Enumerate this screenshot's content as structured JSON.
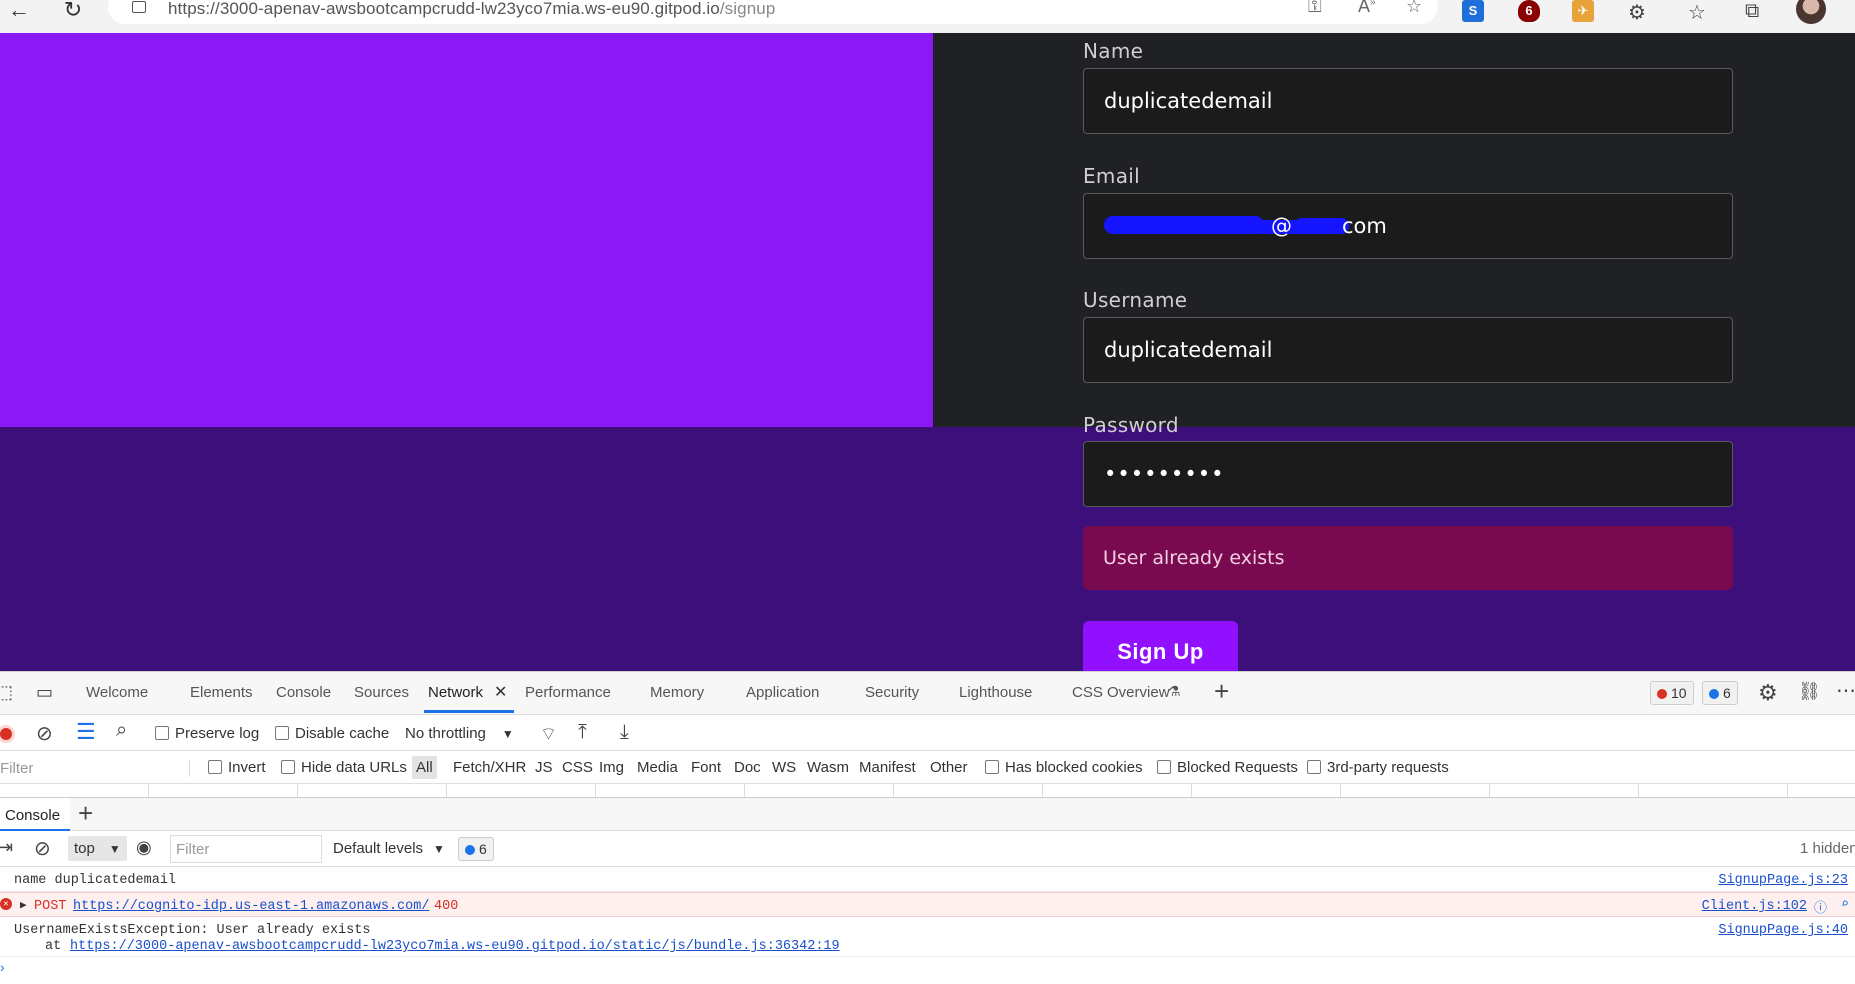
{
  "browser": {
    "url_host": "https://3000-apenav-awsbootcampcrudd-lw23yco7mia.ws-eu90.gitpod.io",
    "url_path": "/signup"
  },
  "form": {
    "name_label": "Name",
    "name_value": "duplicatedemail",
    "email_label": "Email",
    "email_visible_at": "@",
    "email_visible_com": "com",
    "username_label": "Username",
    "username_value": "duplicatedemail",
    "password_label": "Password",
    "password_value": "•••••••••",
    "error_message": "User already exists",
    "submit_label": "Sign Up"
  },
  "devtools": {
    "tabs": [
      "Welcome",
      "Elements",
      "Console",
      "Sources",
      "Network",
      "Performance",
      "Memory",
      "Application",
      "Security",
      "Lighthouse",
      "CSS Overview"
    ],
    "active_tab": "Network",
    "error_count": "10",
    "message_count": "6",
    "network_toolbar": {
      "preserve_log": "Preserve log",
      "disable_cache": "Disable cache",
      "throttling": "No throttling"
    },
    "filter_bar": {
      "filter_placeholder": "Filter",
      "invert": "Invert",
      "hide_data_urls": "Hide data URLs",
      "types": [
        "All",
        "Fetch/XHR",
        "JS",
        "CSS",
        "Img",
        "Media",
        "Font",
        "Doc",
        "WS",
        "Wasm",
        "Manifest",
        "Other"
      ],
      "has_blocked_cookies": "Has blocked cookies",
      "blocked_requests": "Blocked Requests",
      "third_party": "3rd-party requests"
    },
    "drawer": {
      "tab": "Console",
      "context": "top",
      "filter_placeholder": "Filter",
      "levels": "Default levels",
      "msg_count": "6",
      "hidden": "1 hidden"
    },
    "console": {
      "line1_text": "name duplicatedemail",
      "line1_src": "SignupPage.js:23",
      "line2_method": "POST",
      "line2_url": "https://cognito-idp.us-east-1.amazonaws.com/",
      "line2_status": "400",
      "line2_src": "Client.js:102",
      "line3_text": "UsernameExistsException: User already exists",
      "line3_at": "at",
      "line3_url": "https://3000-apenav-awsbootcampcrudd-lw23yco7mia.ws-eu90.gitpod.io/static/js/bundle.js:36342:19",
      "line3_src": "SignupPage.js:40"
    }
  }
}
